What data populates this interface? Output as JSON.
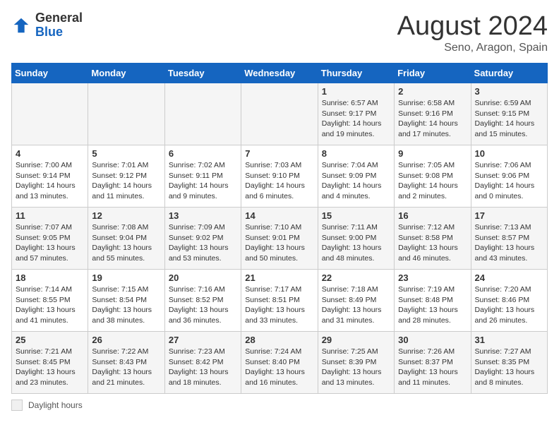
{
  "header": {
    "logo_general": "General",
    "logo_blue": "Blue",
    "title": "August 2024",
    "subtitle": "Seno, Aragon, Spain"
  },
  "weekdays": [
    "Sunday",
    "Monday",
    "Tuesday",
    "Wednesday",
    "Thursday",
    "Friday",
    "Saturday"
  ],
  "legend_label": "Daylight hours",
  "weeks": [
    [
      {
        "day": "",
        "info": ""
      },
      {
        "day": "",
        "info": ""
      },
      {
        "day": "",
        "info": ""
      },
      {
        "day": "",
        "info": ""
      },
      {
        "day": "1",
        "info": "Sunrise: 6:57 AM\nSunset: 9:17 PM\nDaylight: 14 hours\nand 19 minutes."
      },
      {
        "day": "2",
        "info": "Sunrise: 6:58 AM\nSunset: 9:16 PM\nDaylight: 14 hours\nand 17 minutes."
      },
      {
        "day": "3",
        "info": "Sunrise: 6:59 AM\nSunset: 9:15 PM\nDaylight: 14 hours\nand 15 minutes."
      }
    ],
    [
      {
        "day": "4",
        "info": "Sunrise: 7:00 AM\nSunset: 9:14 PM\nDaylight: 14 hours\nand 13 minutes."
      },
      {
        "day": "5",
        "info": "Sunrise: 7:01 AM\nSunset: 9:12 PM\nDaylight: 14 hours\nand 11 minutes."
      },
      {
        "day": "6",
        "info": "Sunrise: 7:02 AM\nSunset: 9:11 PM\nDaylight: 14 hours\nand 9 minutes."
      },
      {
        "day": "7",
        "info": "Sunrise: 7:03 AM\nSunset: 9:10 PM\nDaylight: 14 hours\nand 6 minutes."
      },
      {
        "day": "8",
        "info": "Sunrise: 7:04 AM\nSunset: 9:09 PM\nDaylight: 14 hours\nand 4 minutes."
      },
      {
        "day": "9",
        "info": "Sunrise: 7:05 AM\nSunset: 9:08 PM\nDaylight: 14 hours\nand 2 minutes."
      },
      {
        "day": "10",
        "info": "Sunrise: 7:06 AM\nSunset: 9:06 PM\nDaylight: 14 hours\nand 0 minutes."
      }
    ],
    [
      {
        "day": "11",
        "info": "Sunrise: 7:07 AM\nSunset: 9:05 PM\nDaylight: 13 hours\nand 57 minutes."
      },
      {
        "day": "12",
        "info": "Sunrise: 7:08 AM\nSunset: 9:04 PM\nDaylight: 13 hours\nand 55 minutes."
      },
      {
        "day": "13",
        "info": "Sunrise: 7:09 AM\nSunset: 9:02 PM\nDaylight: 13 hours\nand 53 minutes."
      },
      {
        "day": "14",
        "info": "Sunrise: 7:10 AM\nSunset: 9:01 PM\nDaylight: 13 hours\nand 50 minutes."
      },
      {
        "day": "15",
        "info": "Sunrise: 7:11 AM\nSunset: 9:00 PM\nDaylight: 13 hours\nand 48 minutes."
      },
      {
        "day": "16",
        "info": "Sunrise: 7:12 AM\nSunset: 8:58 PM\nDaylight: 13 hours\nand 46 minutes."
      },
      {
        "day": "17",
        "info": "Sunrise: 7:13 AM\nSunset: 8:57 PM\nDaylight: 13 hours\nand 43 minutes."
      }
    ],
    [
      {
        "day": "18",
        "info": "Sunrise: 7:14 AM\nSunset: 8:55 PM\nDaylight: 13 hours\nand 41 minutes."
      },
      {
        "day": "19",
        "info": "Sunrise: 7:15 AM\nSunset: 8:54 PM\nDaylight: 13 hours\nand 38 minutes."
      },
      {
        "day": "20",
        "info": "Sunrise: 7:16 AM\nSunset: 8:52 PM\nDaylight: 13 hours\nand 36 minutes."
      },
      {
        "day": "21",
        "info": "Sunrise: 7:17 AM\nSunset: 8:51 PM\nDaylight: 13 hours\nand 33 minutes."
      },
      {
        "day": "22",
        "info": "Sunrise: 7:18 AM\nSunset: 8:49 PM\nDaylight: 13 hours\nand 31 minutes."
      },
      {
        "day": "23",
        "info": "Sunrise: 7:19 AM\nSunset: 8:48 PM\nDaylight: 13 hours\nand 28 minutes."
      },
      {
        "day": "24",
        "info": "Sunrise: 7:20 AM\nSunset: 8:46 PM\nDaylight: 13 hours\nand 26 minutes."
      }
    ],
    [
      {
        "day": "25",
        "info": "Sunrise: 7:21 AM\nSunset: 8:45 PM\nDaylight: 13 hours\nand 23 minutes."
      },
      {
        "day": "26",
        "info": "Sunrise: 7:22 AM\nSunset: 8:43 PM\nDaylight: 13 hours\nand 21 minutes."
      },
      {
        "day": "27",
        "info": "Sunrise: 7:23 AM\nSunset: 8:42 PM\nDaylight: 13 hours\nand 18 minutes."
      },
      {
        "day": "28",
        "info": "Sunrise: 7:24 AM\nSunset: 8:40 PM\nDaylight: 13 hours\nand 16 minutes."
      },
      {
        "day": "29",
        "info": "Sunrise: 7:25 AM\nSunset: 8:39 PM\nDaylight: 13 hours\nand 13 minutes."
      },
      {
        "day": "30",
        "info": "Sunrise: 7:26 AM\nSunset: 8:37 PM\nDaylight: 13 hours\nand 11 minutes."
      },
      {
        "day": "31",
        "info": "Sunrise: 7:27 AM\nSunset: 8:35 PM\nDaylight: 13 hours\nand 8 minutes."
      }
    ]
  ]
}
